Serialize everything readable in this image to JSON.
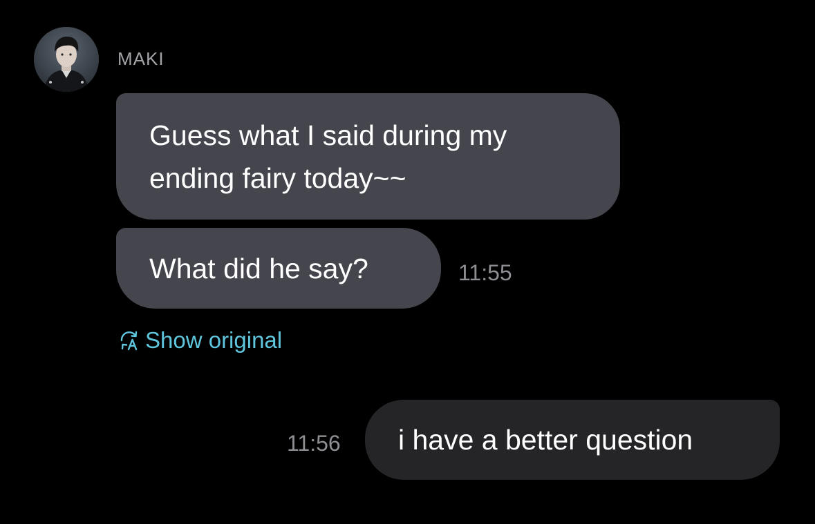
{
  "sender": {
    "name": "MAKI",
    "avatar_icon": "profile-photo"
  },
  "messages": [
    {
      "direction": "incoming",
      "lines": [
        "Guess what I said during my",
        "ending fairy today~~"
      ]
    },
    {
      "direction": "incoming",
      "text": "What did he say?",
      "time": "11:55"
    },
    {
      "direction": "outgoing",
      "text": "i have a better question",
      "time": "11:56"
    }
  ],
  "translation": {
    "show_original_label": "Show original",
    "icon": "translate-icon"
  },
  "colors": {
    "background": "#000000",
    "incoming_bubble": "#45464d",
    "outgoing_bubble": "#252527",
    "link": "#5fc6de",
    "timestamp": "#8e8e93",
    "sender_name": "#a4a4a8"
  }
}
